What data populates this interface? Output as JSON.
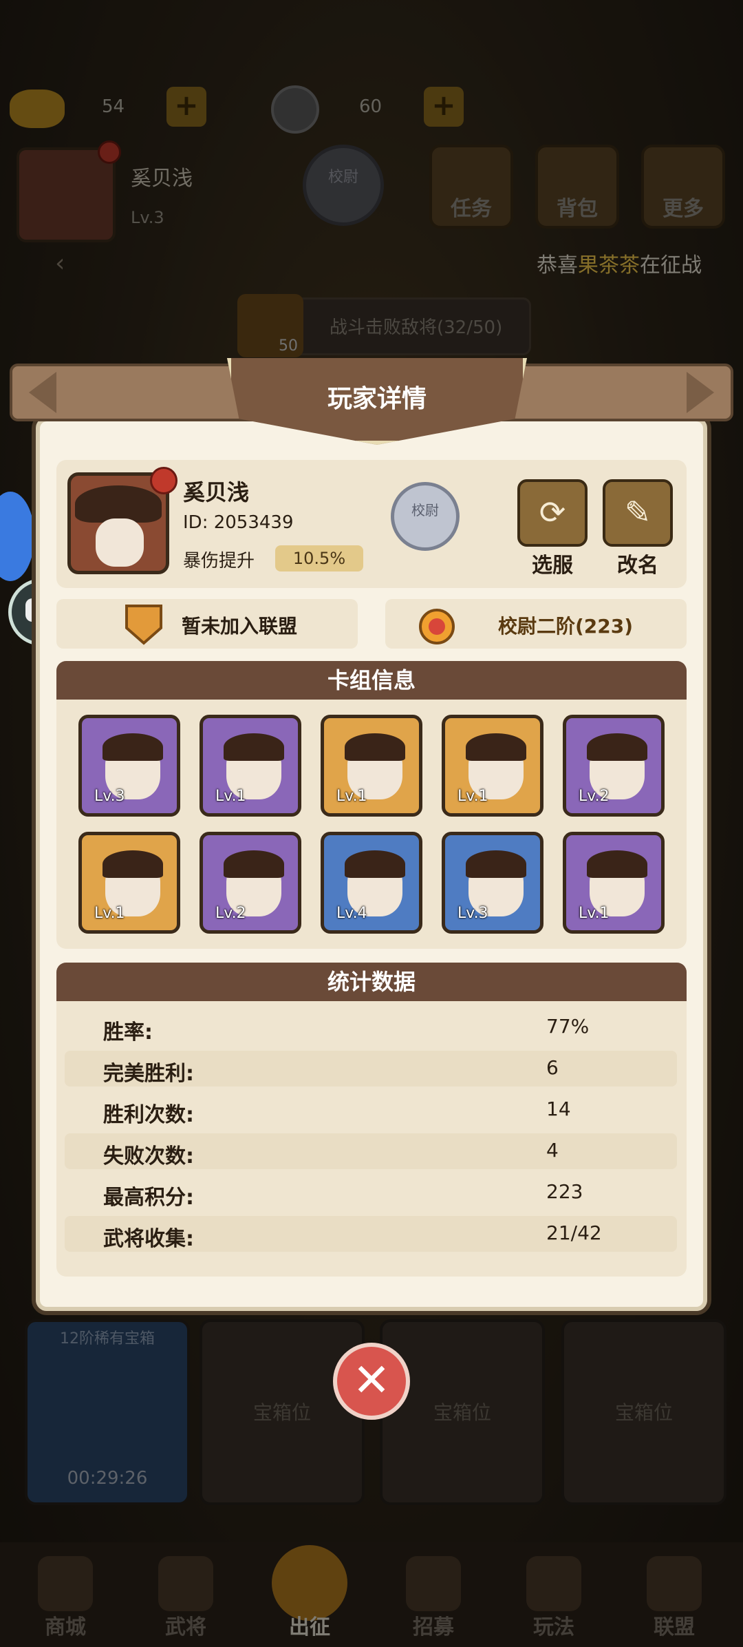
{
  "resources": {
    "gold": "54",
    "coins": "60"
  },
  "top_profile": {
    "name": "奚贝浅",
    "level": "Lv.3",
    "rank_emblem": "校尉"
  },
  "top_buttons": [
    {
      "label": "任务"
    },
    {
      "label": "背包"
    },
    {
      "label": "更多"
    }
  ],
  "notice": {
    "prefix": "恭喜",
    "highlight": "果茶茶",
    "suffix": "在征战"
  },
  "quest": {
    "badge": "50",
    "text": "战斗击败敌将(32/50)"
  },
  "modal": {
    "title": "玩家详情",
    "player": {
      "name": "奚贝浅",
      "id": "ID: 2053439",
      "crit_label": "暴伤提升",
      "crit_value": "10.5%",
      "rank_emblem": "校尉"
    },
    "buttons": {
      "switch_server": "选服",
      "rename": "改名"
    },
    "alliance": "暂未加入联盟",
    "rank": "校尉二阶(223)",
    "deck": {
      "title": "卡组信息",
      "cards": [
        {
          "level": "Lv.3",
          "rarity": "purple"
        },
        {
          "level": "Lv.1",
          "rarity": "purple"
        },
        {
          "level": "Lv.1",
          "rarity": "orange"
        },
        {
          "level": "Lv.1",
          "rarity": "orange"
        },
        {
          "level": "Lv.2",
          "rarity": "purple"
        },
        {
          "level": "Lv.1",
          "rarity": "orange"
        },
        {
          "level": "Lv.2",
          "rarity": "purple"
        },
        {
          "level": "Lv.4",
          "rarity": "blue"
        },
        {
          "level": "Lv.3",
          "rarity": "blue"
        },
        {
          "level": "Lv.1",
          "rarity": "purple"
        }
      ]
    },
    "stats": {
      "title": "统计数据",
      "rows": [
        {
          "label": "胜率:",
          "value": "77%"
        },
        {
          "label": "完美胜利:",
          "value": "6"
        },
        {
          "label": "胜利次数:",
          "value": "14"
        },
        {
          "label": "失败次数:",
          "value": "4"
        },
        {
          "label": "最高积分:",
          "value": "223"
        },
        {
          "label": "武将收集:",
          "value": "21/42"
        }
      ]
    }
  },
  "chests": {
    "first_label": "12阶稀有宝箱",
    "first_timer": "00:29:26",
    "empty_label": "宝箱位"
  },
  "nav": [
    {
      "label": "商城"
    },
    {
      "label": "武将"
    },
    {
      "label": "出征"
    },
    {
      "label": "招募"
    },
    {
      "label": "玩法"
    },
    {
      "label": "联盟"
    }
  ],
  "colors": {
    "accent_gold": "#f2c84b",
    "card_purple": "#8a67b8",
    "card_orange": "#e0a44a",
    "card_blue": "#4f7cc2",
    "close_red": "#d8554e"
  }
}
